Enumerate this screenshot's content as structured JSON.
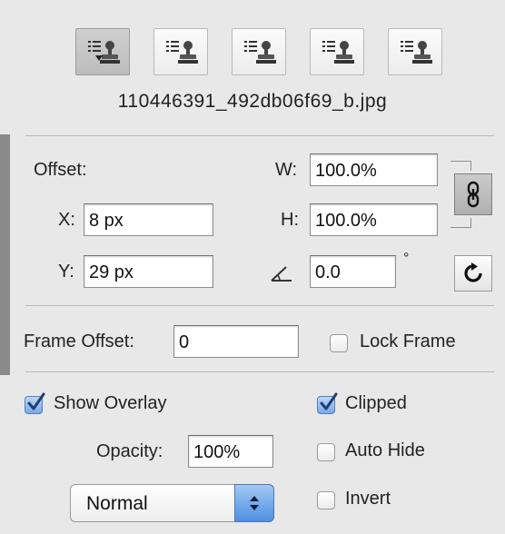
{
  "source_buttons": [
    {
      "icon": "clone-source-icon",
      "selected": true
    },
    {
      "icon": "clone-source-icon",
      "selected": false
    },
    {
      "icon": "clone-source-icon",
      "selected": false
    },
    {
      "icon": "clone-source-icon",
      "selected": false
    },
    {
      "icon": "clone-source-icon",
      "selected": false
    }
  ],
  "filename": "110446391_492db06f69_b.jpg",
  "offset": {
    "label": "Offset:",
    "x_label": "X:",
    "x_value": "8 px",
    "y_label": "Y:",
    "y_value": "29 px",
    "w_label": "W:",
    "w_value": "100.0%",
    "h_label": "H:",
    "h_value": "100.0%",
    "angle_value": "0.0",
    "degree_symbol": "°",
    "link_icon": "link-chain-icon",
    "reset_icon": "reset-transform-icon"
  },
  "frame": {
    "label": "Frame Offset:",
    "value": "0",
    "lock_label": "Lock Frame",
    "lock_checked": false
  },
  "overlay": {
    "show_label": "Show Overlay",
    "show_checked": true,
    "clipped_label": "Clipped",
    "clipped_checked": true,
    "opacity_label": "Opacity:",
    "opacity_value": "100%",
    "auto_hide_label": "Auto Hide",
    "auto_hide_checked": false,
    "blend_mode": "Normal",
    "invert_label": "Invert",
    "invert_checked": false
  },
  "colors": {
    "panel_bg": "#e8e8e8",
    "accent_blue": "#4f8fe0",
    "border": "#8e8e8e"
  }
}
